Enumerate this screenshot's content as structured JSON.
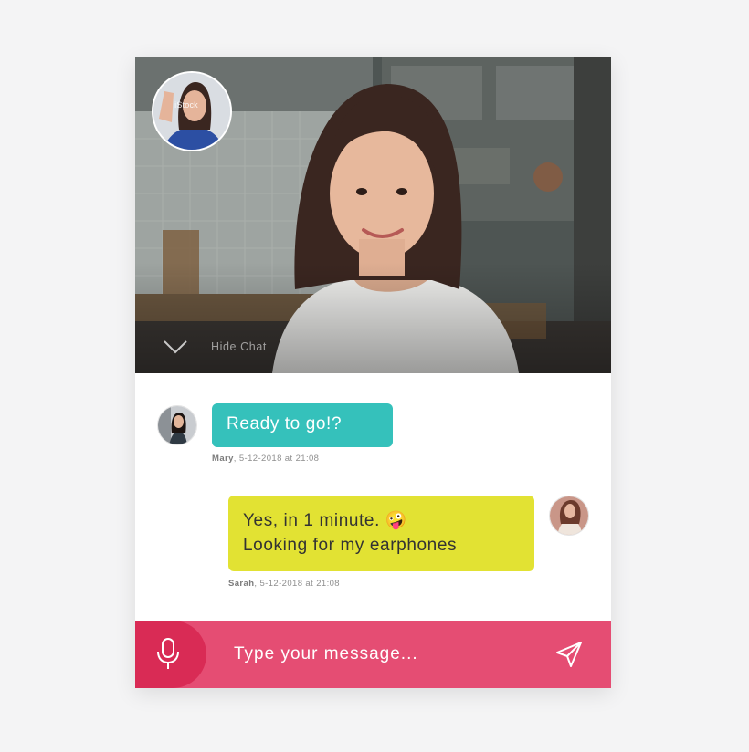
{
  "video": {
    "watermark": "iStock",
    "hide_chat_label": "Hide Chat"
  },
  "messages": [
    {
      "text_lines": [
        "Ready to go!?"
      ],
      "sender": "Mary",
      "timestamp": ", 5-12-2018 at 21:08",
      "bubble_color": "#35c1bb"
    },
    {
      "text_lines": [
        "Yes, in 1 minute. 🤪",
        "Looking for my earphones"
      ],
      "sender": "Sarah",
      "timestamp": ", 5-12-2018 at 21:08",
      "bubble_color": "#e2e233"
    }
  ],
  "input": {
    "placeholder": "Type your message...",
    "value": "",
    "bar_color": "#e54d73",
    "mic_color": "#d92b55"
  },
  "icons": {
    "hide_chat": "chevron-down-icon",
    "mic": "microphone-icon",
    "send": "paper-plane-icon"
  }
}
